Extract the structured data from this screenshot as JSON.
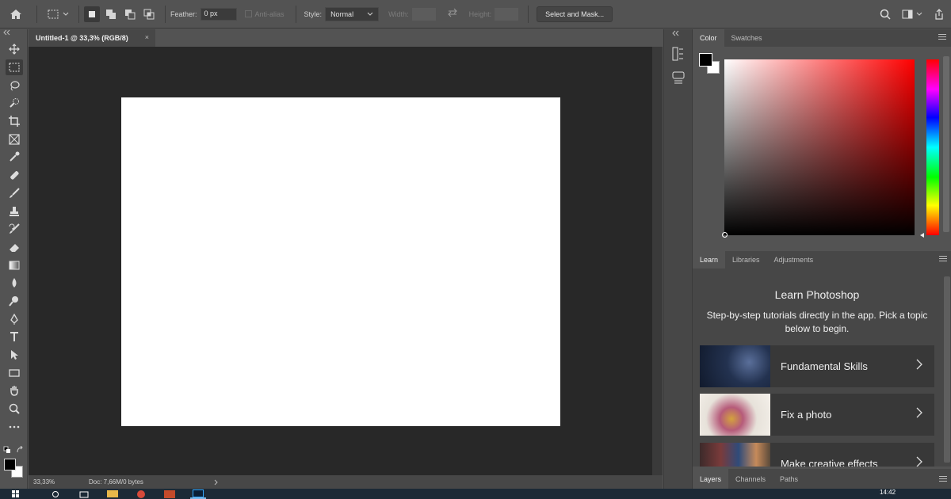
{
  "options_bar": {
    "feather_label": "Feather:",
    "feather_value": "0 px",
    "antialias_label": "Anti-alias",
    "style_label": "Style:",
    "style_value": "Normal",
    "width_label": "Width:",
    "height_label": "Height:",
    "select_and_mask_label": "Select and Mask..."
  },
  "document": {
    "tab_title": "Untitled-1 @ 33,3% (RGB/8)",
    "close_glyph": "×",
    "zoom_level": "33,33%",
    "doc_info": "Doc: 7,66M/0 bytes"
  },
  "color_panel": {
    "tabs": [
      "Color",
      "Swatches"
    ],
    "active_tab": "Color",
    "foreground_color": "#000000",
    "background_color": "#ffffff",
    "hue_color": "#ff0000"
  },
  "learn_panel": {
    "tabs": [
      "Learn",
      "Libraries",
      "Adjustments"
    ],
    "title": "Learn Photoshop",
    "subtitle": "Step-by-step tutorials directly in the app. Pick a topic below to begin.",
    "cards": [
      {
        "label": "Fundamental Skills"
      },
      {
        "label": "Fix a photo"
      },
      {
        "label": "Make creative effects"
      }
    ]
  },
  "layers_panel": {
    "tabs": [
      "Layers",
      "Channels",
      "Paths"
    ]
  },
  "taskbar": {
    "clock": "14:42"
  },
  "tools": [
    "move-tool",
    "rectangular-marquee-tool",
    "lasso-tool",
    "quick-selection-tool",
    "crop-tool",
    "frame-tool",
    "eyedropper-tool",
    "spot-healing-tool",
    "brush-tool",
    "clone-stamp-tool",
    "history-brush-tool",
    "eraser-tool",
    "gradient-tool",
    "blur-tool",
    "dodge-tool",
    "pen-tool",
    "type-tool",
    "path-selection-tool",
    "rectangle-tool",
    "hand-tool",
    "zoom-tool",
    "more-tools"
  ]
}
